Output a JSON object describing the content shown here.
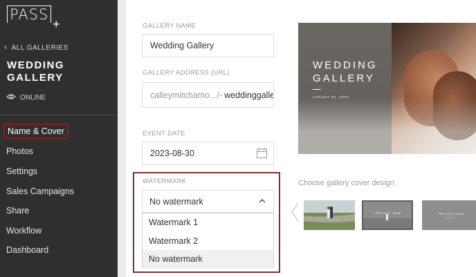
{
  "app": {
    "logo_text": "PASS",
    "logo_plus": "+"
  },
  "sidebar": {
    "back_label": "ALL GALLERIES",
    "gallery_title_line1": "WEDDING",
    "gallery_title_line2": "GALLERY",
    "status_label": "ONLINE",
    "items": [
      {
        "label": "Name & Cover",
        "active": true
      },
      {
        "label": "Photos"
      },
      {
        "label": "Settings"
      },
      {
        "label": "Sales Campaigns"
      },
      {
        "label": "Share"
      },
      {
        "label": "Workflow"
      },
      {
        "label": "Dashboard"
      }
    ]
  },
  "form": {
    "gallery_name_label": "GALLERY NAME",
    "gallery_name_value": "Wedding Gallery",
    "address_label": "GALLERY ADDRESS (URL)",
    "address_prefix": "calleymitchamo.../-",
    "address_slug": "weddinggallery",
    "event_date_label": "EVENT DATE",
    "event_date_value": "2023-08-30",
    "watermark_label": "WATERMARK",
    "watermark_selected": "No watermark",
    "watermark_options": [
      "Watermark 1",
      "Watermark 2",
      "No watermark"
    ]
  },
  "cover": {
    "title_line1": "WEDDING",
    "title_line2": "GALLERY",
    "date": "AUGUST 30, 2023",
    "caption": "Choose gallery cover design",
    "thumb2_text": "PROJECT NAME",
    "thumb3_text": "PROJECT NAME"
  },
  "colors": {
    "sidebar_bg": "#2f2f2f",
    "highlight": "#8b1e1e",
    "field_border": "#dcdcdc"
  }
}
